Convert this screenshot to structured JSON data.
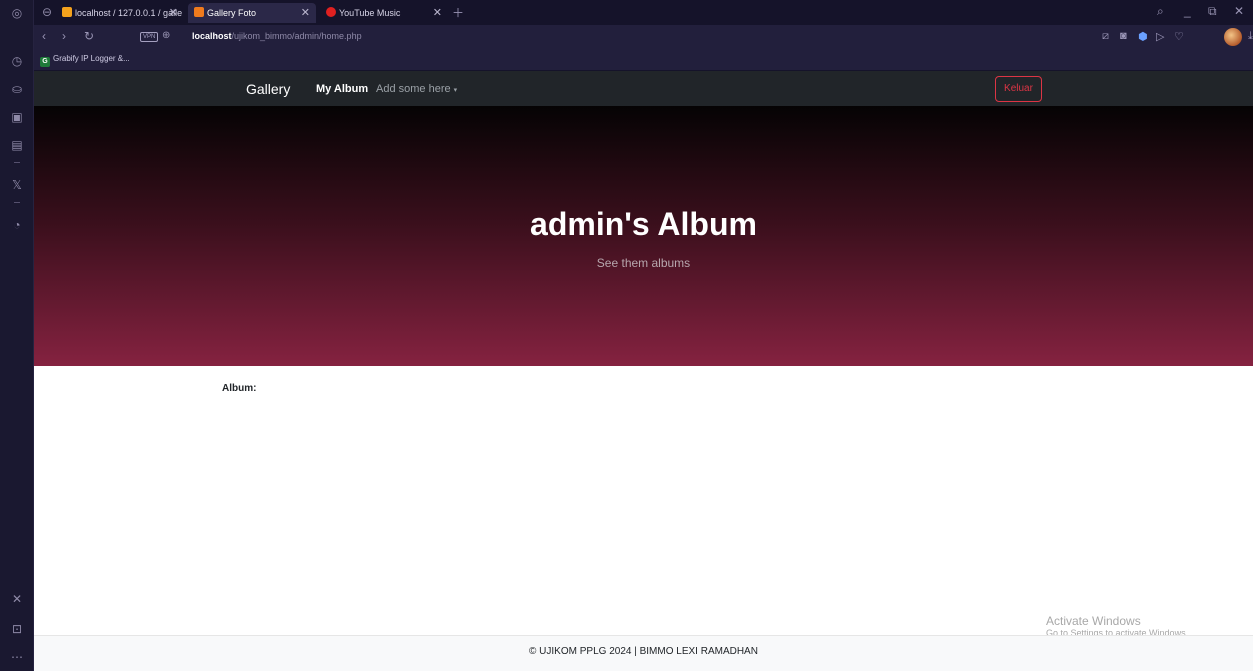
{
  "browser": {
    "tabs": [
      {
        "label": "localhost / 127.0.0.1 / galle",
        "favicon_color": "#f4a21d"
      },
      {
        "label": "Gallery Foto",
        "favicon_color": "#f07b1d"
      },
      {
        "label": "YouTube Music",
        "favicon_color": "#e02020"
      }
    ],
    "url_host": "localhost",
    "url_path": "/ujikom_bimmo/admin/home.php",
    "vpn_label": "VPN",
    "bookmarks": [
      {
        "label": "Grabify IP Logger &..."
      }
    ]
  },
  "navbar": {
    "brand": "Gallery",
    "links": [
      {
        "label": "My Album"
      },
      {
        "label": "Add some here"
      }
    ],
    "logout_label": "Keluar"
  },
  "hero": {
    "title": "admin's Album",
    "subtitle": "See them albums"
  },
  "content": {
    "album_label": "Album:"
  },
  "footer": {
    "text": "© UJIKOM PPLG 2024 | BIMMO LEXI RAMADHAN"
  },
  "os_watermark": {
    "title": "Activate Windows",
    "subtitle": "Go to Settings to activate Windows."
  },
  "colors": {
    "navbar_bg": "#212529",
    "logout_red": "#dc3545",
    "hero_top": "#050304",
    "hero_bottom": "#852240"
  }
}
